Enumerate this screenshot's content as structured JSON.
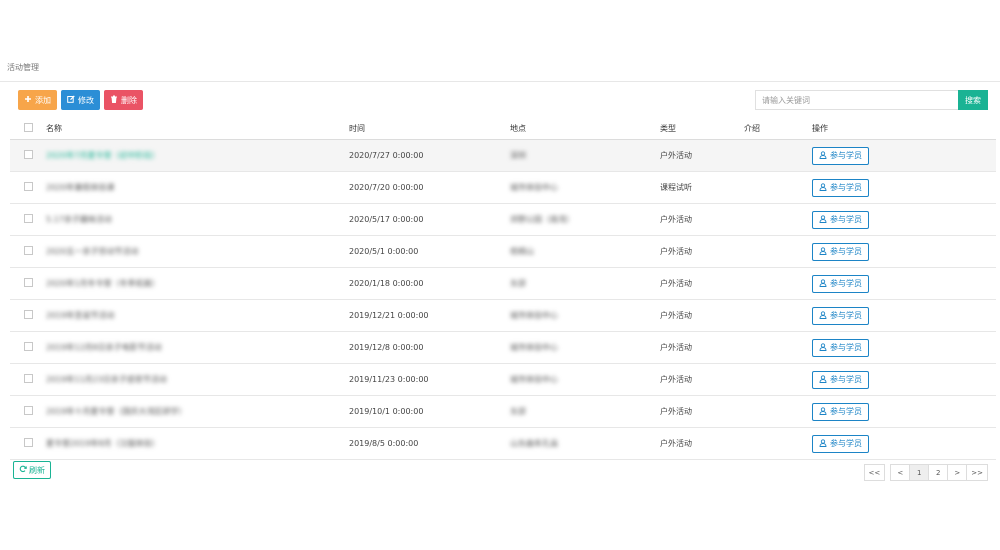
{
  "breadcrumb": "活动管理",
  "toolbar": {
    "add_label": "添加",
    "edit_label": "修改",
    "delete_label": "删除"
  },
  "search": {
    "placeholder": "请输入关键词",
    "button_label": "搜索"
  },
  "table": {
    "headers": {
      "name": "名称",
      "time": "时间",
      "location": "地点",
      "type": "类型",
      "intro": "介绍",
      "action": "操作"
    },
    "action_label": "参与学员",
    "rows": [
      {
        "name": "2020年7月夏令营（初中阶段）",
        "time": "2020/7/27 0:00:00",
        "location": "深圳",
        "type": "户外活动"
      },
      {
        "name": "2020年暑假体验课",
        "time": "2020/7/20 0:00:00",
        "location": "城市体验中心",
        "type": "课程试听"
      },
      {
        "name": "5.17亲子趣味活动",
        "time": "2020/5/17 0:00:00",
        "location": "郊野公园（南湾）",
        "type": "户外活动"
      },
      {
        "name": "2020五一亲子劳动节活动",
        "time": "2020/5/1 0:00:00",
        "location": "梧桐山",
        "type": "户外活动"
      },
      {
        "name": "2020年1月冬令营（冬季拓展）",
        "time": "2020/1/18 0:00:00",
        "location": "东部",
        "type": "户外活动"
      },
      {
        "name": "2019年圣诞节活动",
        "time": "2019/12/21 0:00:00",
        "location": "城市体验中心",
        "type": "户外活动"
      },
      {
        "name": "2019年12月8日亲子电影节活动",
        "time": "2019/12/8 0:00:00",
        "location": "城市体验中心",
        "type": "户外活动"
      },
      {
        "name": "2019年11月23日亲子感恩节活动",
        "time": "2019/11/23 0:00:00",
        "location": "城市体验中心",
        "type": "户外活动"
      },
      {
        "name": "2019年十月夏令营（国庆大湾区研学）",
        "time": "2019/10/1 0:00:00",
        "location": "东部",
        "type": "户外活动"
      },
      {
        "name": "夏令营2019年8月（汉服体验）",
        "time": "2019/8/5 0:00:00",
        "location": "山东曲阜孔庙",
        "type": "户外活动"
      }
    ]
  },
  "refresh_label": "刷新",
  "pagination": {
    "first": "<<",
    "prev": "<",
    "pages": [
      "1",
      "2"
    ],
    "next": ">",
    "last": ">>"
  },
  "icons": {
    "add": "plus-icon",
    "edit": "edit-icon",
    "delete": "trash-icon",
    "user": "user-icon",
    "refresh": "refresh-icon"
  },
  "colors": {
    "add": "#f7a54a",
    "edit": "#2b8ed6",
    "delete": "#ea5365",
    "primary": "#1ab394",
    "action": "#1c84c6"
  }
}
